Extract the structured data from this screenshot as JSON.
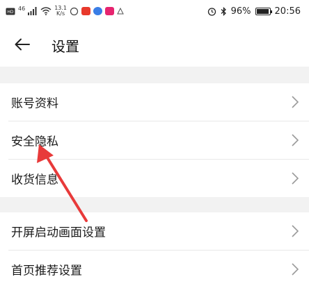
{
  "statusbar": {
    "network_label": "46",
    "speed_value": "13.1",
    "speed_unit": "K/s",
    "battery_percent": "96%",
    "time": "20:56",
    "battery_level": 0.96,
    "app_icon_colors": [
      "#e8392c",
      "#3a7ee6",
      "#e6246f"
    ]
  },
  "header": {
    "back_icon": "arrow-left-icon",
    "title": "设置"
  },
  "settings": {
    "group1": [
      {
        "label": "账号资料"
      },
      {
        "label": "安全隐私"
      },
      {
        "label": "收货信息"
      }
    ],
    "group2": [
      {
        "label": "开屏启动画面设置"
      },
      {
        "label": "首页推荐设置"
      }
    ]
  },
  "annotation": {
    "color": "#e83a3a",
    "icon": "red-arrow-annotation"
  }
}
